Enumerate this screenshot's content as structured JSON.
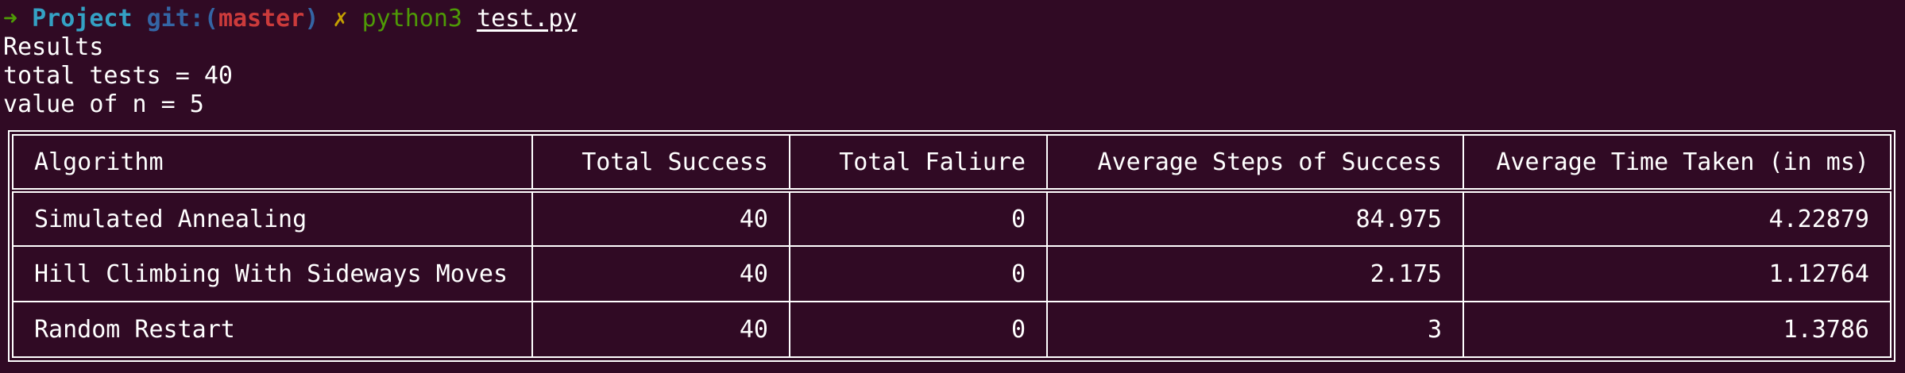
{
  "prompt": {
    "arrow": "➜",
    "directory": "Project",
    "git_label": "git:(",
    "branch": "master",
    "git_close": ")",
    "dirty_mark": "✗",
    "command": "python3",
    "argument": "test.py"
  },
  "output": {
    "line1": "Results",
    "line2": "total tests = 40",
    "line3": "value of n = 5"
  },
  "table": {
    "headers": [
      "Algorithm",
      "Total Success",
      "Total Faliure",
      "Average Steps of Success",
      "Average Time Taken (in ms)"
    ],
    "rows": [
      [
        "Simulated Annealing",
        "40",
        "0",
        "84.975",
        "4.22879"
      ],
      [
        "Hill Climbing With Sideways Moves",
        "40",
        "0",
        "2.175",
        "1.12764"
      ],
      [
        "Random Restart",
        "40",
        "0",
        "3",
        "1.3786"
      ]
    ]
  },
  "colors": {
    "background": "#300a24",
    "prompt_arrow": "#4e9a06",
    "directory": "#34a1c4",
    "git": "#3465a4",
    "branch": "#cc3b3b",
    "dirty_mark": "#c4a000",
    "command": "#4e9a06"
  }
}
